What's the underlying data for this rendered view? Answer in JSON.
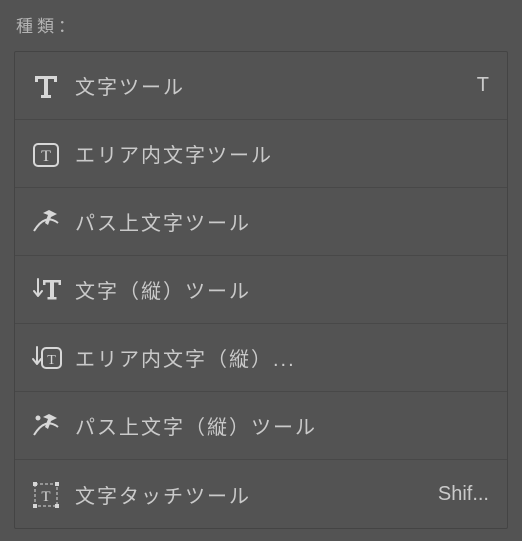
{
  "header": {
    "label": "種類："
  },
  "tools": [
    {
      "id": "type-tool",
      "label": "文字ツール",
      "shortcut": "T",
      "icon": "type-icon"
    },
    {
      "id": "area-type-tool",
      "label": "エリア内文字ツール",
      "shortcut": "",
      "icon": "area-type-icon"
    },
    {
      "id": "path-type-tool",
      "label": "パス上文字ツール",
      "shortcut": "",
      "icon": "path-type-icon"
    },
    {
      "id": "vertical-type-tool",
      "label": "文字（縦）ツール",
      "shortcut": "",
      "icon": "vertical-type-icon"
    },
    {
      "id": "vertical-area-type-tool",
      "label": "エリア内文字（縦）...",
      "shortcut": "",
      "icon": "vertical-area-type-icon"
    },
    {
      "id": "vertical-path-type-tool",
      "label": "パス上文字（縦）ツール",
      "shortcut": "",
      "icon": "vertical-path-type-icon"
    },
    {
      "id": "touch-type-tool",
      "label": "文字タッチツール",
      "shortcut": "Shif...",
      "icon": "touch-type-icon"
    }
  ]
}
